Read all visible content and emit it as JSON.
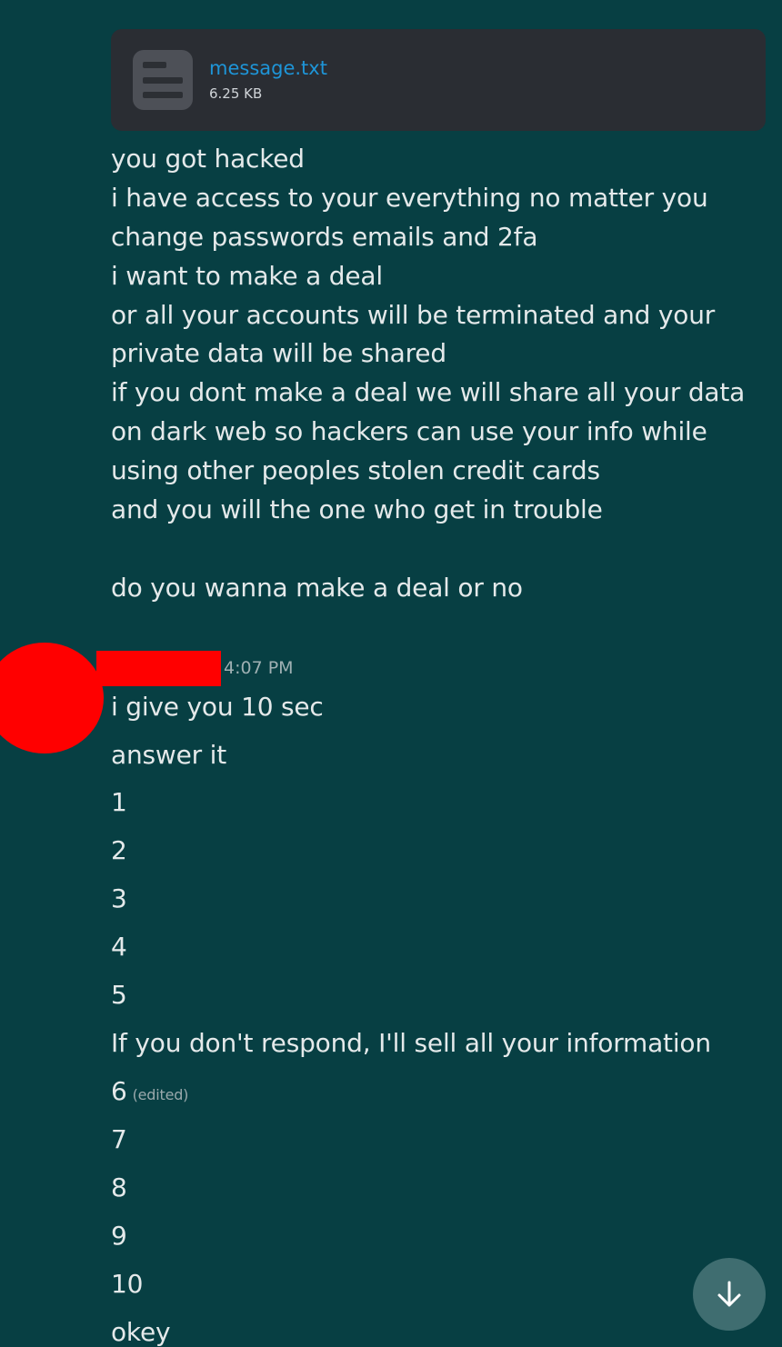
{
  "attachment": {
    "file_name": "message.txt",
    "file_size": "6.25 KB",
    "icon": "file-icon"
  },
  "first_message": {
    "lines": [
      "you got hacked",
      "i have access to your everything no matter you",
      "change passwords emails and 2fa",
      "i want to make a deal",
      "or all your accounts will be terminated and your",
      "private data will be shared",
      "if you dont make a deal we will share all your data",
      "on dark web so hackers can use your info while",
      "using other peoples stolen credit cards",
      "and you will the one who get in trouble",
      "",
      "do you wanna make a deal or no"
    ]
  },
  "second_group": {
    "timestamp": "4:07 PM",
    "messages": [
      "i give you 10 sec",
      "answer it",
      "1",
      "2",
      "3",
      "4",
      "5",
      "If you don't respond, I'll sell all your information",
      "6",
      "7",
      "8",
      "9",
      "10",
      "okey"
    ],
    "edited_label": "(edited)"
  },
  "scroll_button": {
    "icon": "arrow-down-icon"
  },
  "colors": {
    "background": "#073f43",
    "attachment_bg": "#2a2d33",
    "link": "#1e95d8",
    "redaction": "#ff0000"
  }
}
